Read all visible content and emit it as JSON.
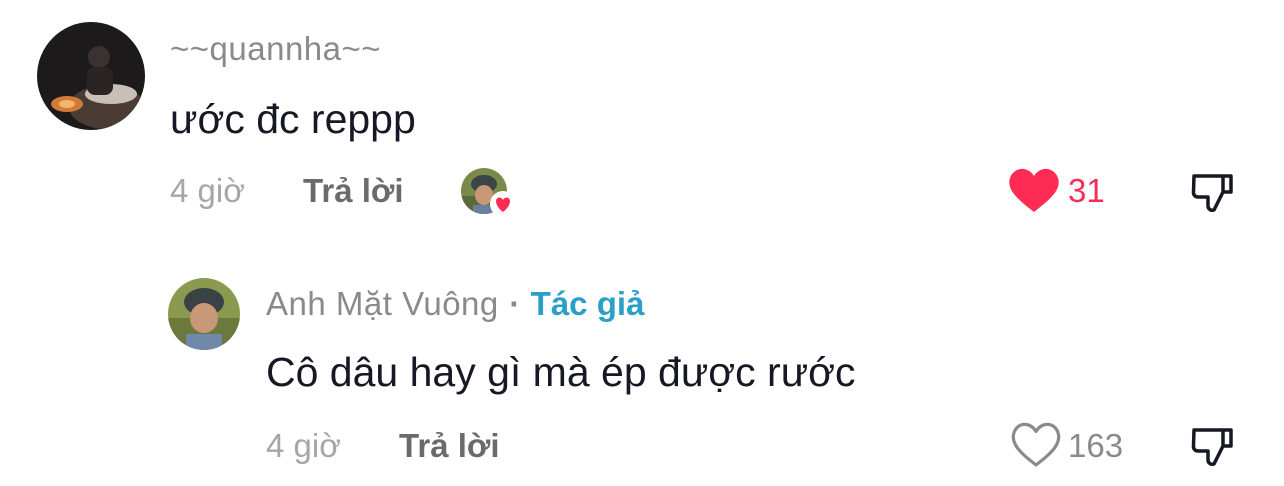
{
  "comments": [
    {
      "username": "~~quannha~~",
      "text": "ước đc reppp",
      "time": "4 giờ",
      "reply_label": "Trả lời",
      "likes": "31",
      "liked": true,
      "liked_by_creator": true,
      "avatar_icon": "avatar-dark-photo"
    }
  ],
  "reply": {
    "username": "Anh Mặt Vuông",
    "separator": "·",
    "badge": "Tác giả",
    "text": "Cô dâu hay gì mà ép được rước",
    "time": "4 giờ",
    "reply_label": "Trả lời",
    "likes": "163",
    "liked": false,
    "avatar_icon": "avatar-helmet-photo"
  },
  "icons": {
    "heart_filled": "heart-filled-icon",
    "heart_outline": "heart-outline-icon",
    "dislike": "dislike-icon"
  },
  "colors": {
    "like_red": "#fe2c55",
    "author_blue": "#2a9fc7",
    "text_dark": "#161823",
    "muted": "#8a8a8a"
  }
}
